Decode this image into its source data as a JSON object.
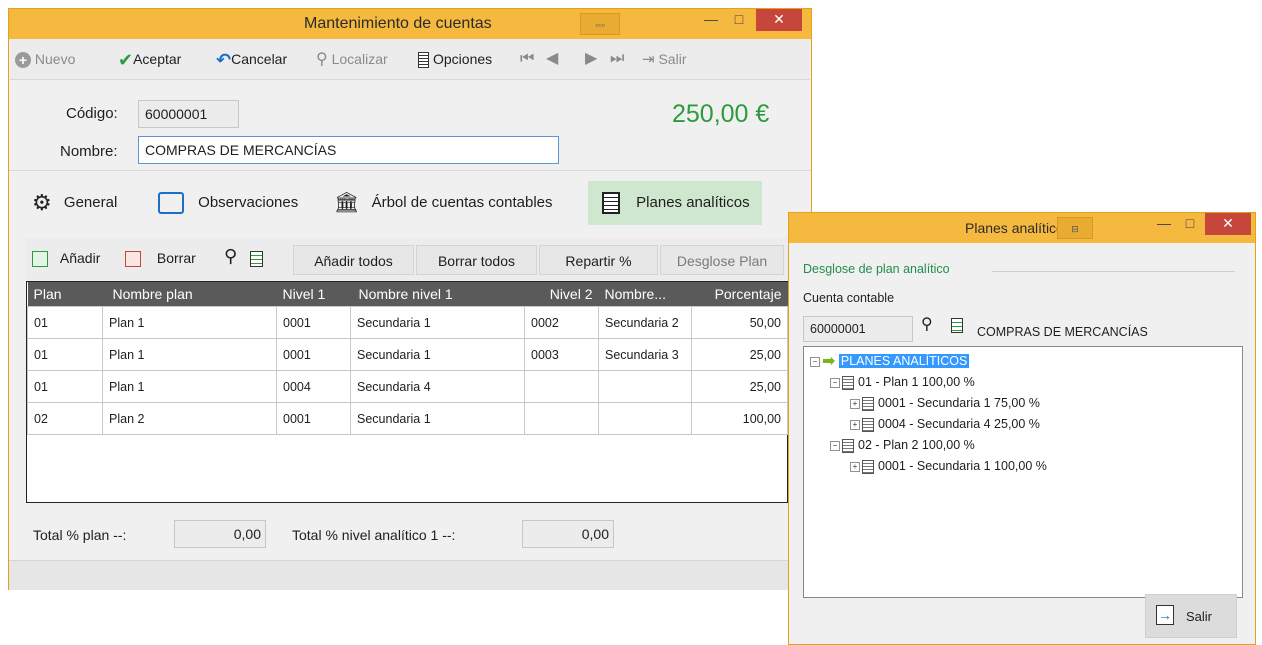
{
  "main": {
    "title": "Mantenimiento de cuentas",
    "grip": "▫▫▫",
    "toolbar": {
      "nuevo": "Nuevo",
      "aceptar": "Aceptar",
      "cancelar": "Cancelar",
      "localizar": "Localizar",
      "opciones": "Opciones",
      "salir": "Salir"
    },
    "codigo_label": "Código:",
    "codigo_value": "60000001",
    "nombre_label": "Nombre:",
    "nombre_value": "COMPRAS DE MERCANCÍAS",
    "amount": "250,00 €",
    "tabs": [
      "General",
      "Observaciones",
      "Árbol de cuentas contables",
      "Planes analíticos"
    ],
    "grid_buttons": {
      "anadir": "Añadir",
      "borrar": "Borrar",
      "anadir_todos": "Añadir todos",
      "borrar_todos": "Borrar todos",
      "repartir": "Repartir %",
      "desglose": "Desglose Plan"
    },
    "columns": [
      "Plan",
      "Nombre plan",
      "Nivel 1",
      "Nombre nivel 1",
      "Nivel 2",
      "Nombre...",
      "Porcentaje"
    ],
    "rows": [
      [
        "01",
        "Plan 1",
        "0001",
        "Secundaria 1",
        "0002",
        "Secundaria 2",
        "50,00"
      ],
      [
        "01",
        "Plan 1",
        "0001",
        "Secundaria 1",
        "0003",
        "Secundaria 3",
        "25,00"
      ],
      [
        "01",
        "Plan 1",
        "0004",
        "Secundaria 4",
        "",
        "",
        "25,00"
      ],
      [
        "02",
        "Plan 2",
        "0001",
        "Secundaria 1",
        "",
        "",
        "100,00"
      ]
    ],
    "total_plan_label": "Total % plan --:",
    "total_plan_value": "0,00",
    "total_nivel_label": "Total % nivel analítico 1 --:",
    "total_nivel_value": "0,00"
  },
  "popup": {
    "title": "Planes analíticos",
    "section": "Desglose de plan analítico",
    "cuenta_label": "Cuenta contable",
    "cuenta_value": "60000001",
    "cuenta_name": "COMPRAS DE MERCANCÍAS",
    "tree": {
      "root": "PLANES ANALÍTICOS",
      "n1": "01 - Plan 1   100,00 %",
      "n1a": "0001 - Secundaria 1   75,00 %",
      "n1b": "0004 - Secundaria 4   25,00 %",
      "n2": "02 - Plan 2   100,00 %",
      "n2a": "0001 - Secundaria 1   100,00 %"
    },
    "salir": "Salir"
  },
  "colors": {
    "title_bar": "#f6b93f",
    "amount": "#2e9a3e",
    "accent_green": "#1f8f4a",
    "close": "#c7463b",
    "selection": "#3399ff"
  }
}
